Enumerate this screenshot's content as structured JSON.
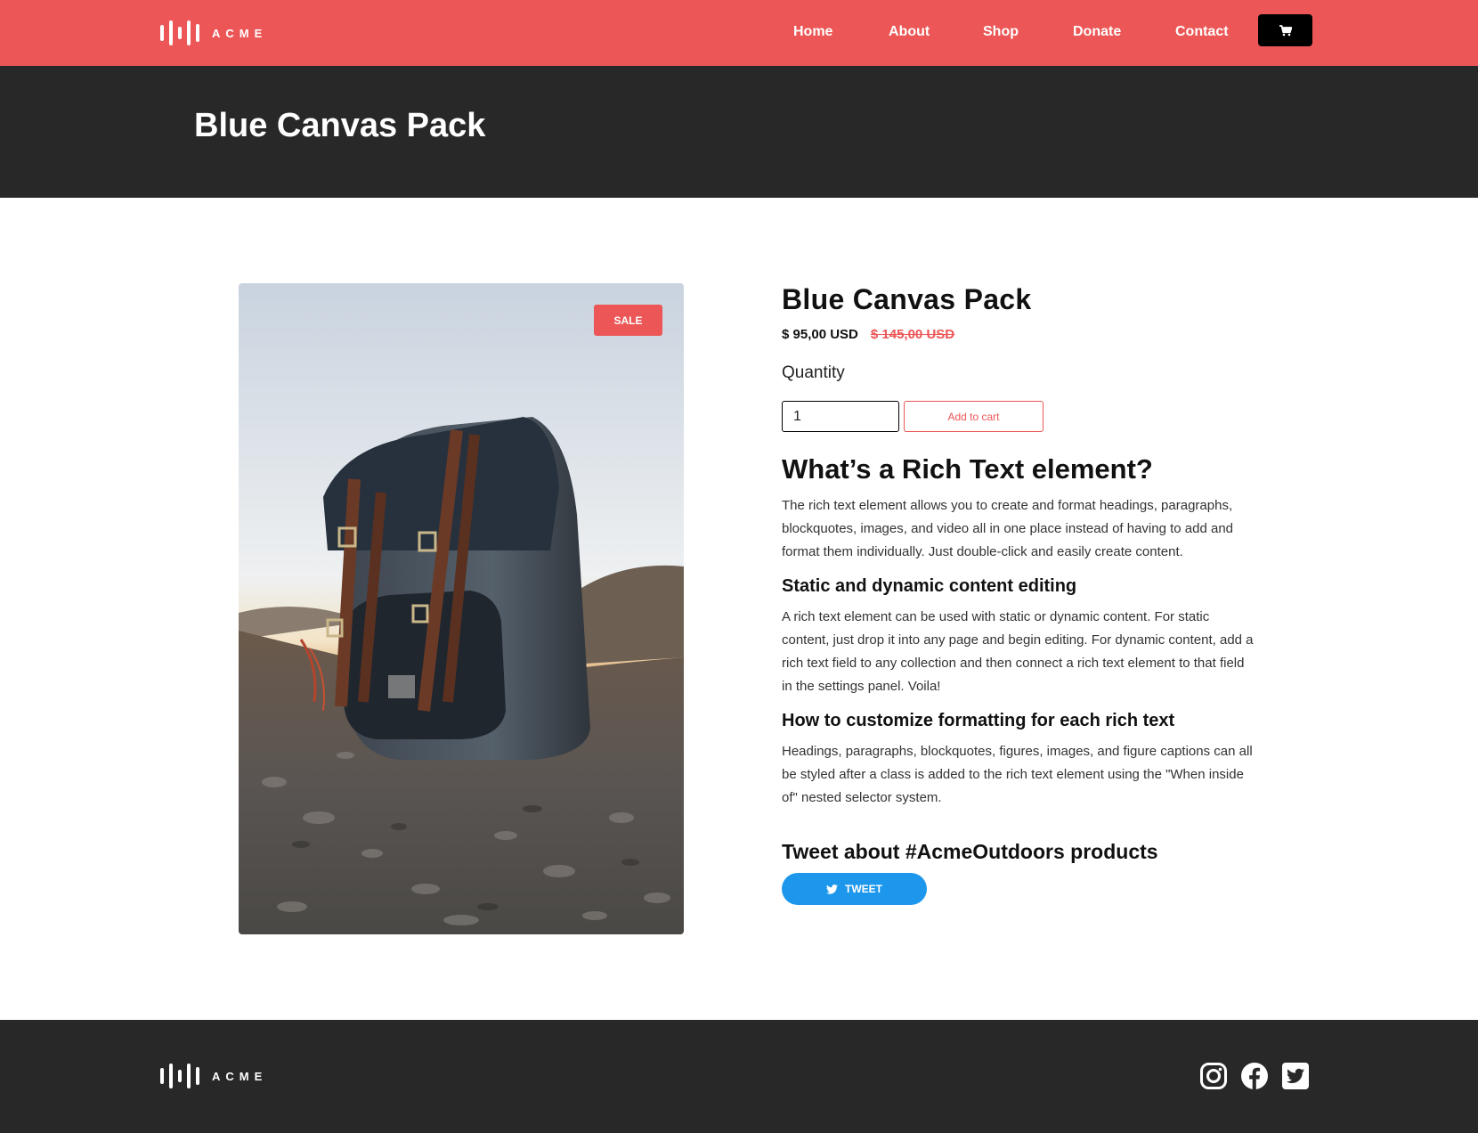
{
  "brand": {
    "logo_text": "ACME"
  },
  "nav": {
    "items": [
      {
        "label": "Home"
      },
      {
        "label": "About"
      },
      {
        "label": "Shop"
      },
      {
        "label": "Donate"
      },
      {
        "label": "Contact"
      }
    ],
    "cart_icon": "cart-icon"
  },
  "hero": {
    "title": "Blue Canvas Pack"
  },
  "product": {
    "badge": "SALE",
    "name": "Blue Canvas Pack",
    "price": "$ 95,00 USD",
    "compare_price": "$ 145,00 USD",
    "quantity_label": "Quantity",
    "quantity_value": "1",
    "add_to_cart_label": "Add to cart",
    "image": "backpack-photo"
  },
  "rich_text": {
    "heading": "What’s a Rich Text element?",
    "intro": "The rich text element allows you to create and format headings, paragraphs, blockquotes, images, and video all in one place instead of having to add and format them individually. Just double-click and easily create content.",
    "section1_heading": "Static and dynamic content editing",
    "section1_text": "A rich text element can be used with static or dynamic content. For static content, just drop it into any page and begin editing. For dynamic content, add a rich text field to any collection and then connect a rich text element to that field in the settings panel. Voila!",
    "section2_heading": "How to customize formatting for each rich text",
    "section2_text": "Headings, paragraphs, blockquotes, figures, images, and figure captions can all be styled after a class is added to the rich text element using the \"When inside of\" nested selector system."
  },
  "tweet": {
    "heading": "Tweet about #AcmeOutdoors products",
    "button_label": "TWEET",
    "icon": "twitter-bird-icon"
  },
  "footer": {
    "logo_text": "ACME",
    "social": [
      "instagram-icon",
      "facebook-icon",
      "twitter-icon"
    ]
  },
  "colors": {
    "accent": "#ec5656",
    "dark": "#282828",
    "tweet_blue": "#1c97ec"
  }
}
